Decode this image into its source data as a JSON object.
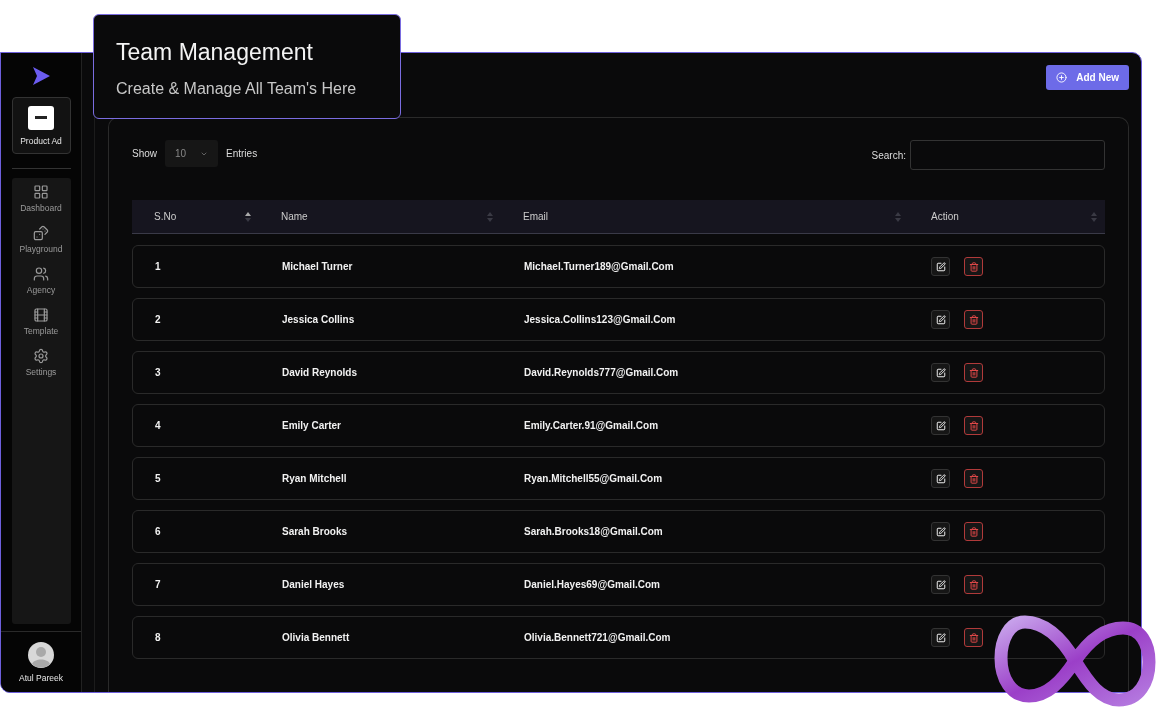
{
  "callout": {
    "title": "Team Management",
    "subtitle": "Create & Manage All Team's Here"
  },
  "sidebar": {
    "project": {
      "label": "Product Ad"
    },
    "items": [
      {
        "label": "Dashboard",
        "kind": "dashboard"
      },
      {
        "label": "Playground",
        "kind": "playground"
      },
      {
        "label": "Agency",
        "kind": "agency"
      },
      {
        "label": "Template",
        "kind": "template"
      },
      {
        "label": "Settings",
        "kind": "settings"
      }
    ],
    "user": {
      "name": "Atul Pareek"
    }
  },
  "header": {
    "add_button": "Add New"
  },
  "table_controls": {
    "show_label": "Show",
    "page_size": "10",
    "entries_label": "Entries",
    "search_label": "Search:"
  },
  "table": {
    "columns": [
      {
        "label": "S.No",
        "sorted": true
      },
      {
        "label": "Name",
        "sorted": false
      },
      {
        "label": "Email",
        "sorted": false
      },
      {
        "label": "Action",
        "sorted": false
      }
    ],
    "rows": [
      {
        "no": "1",
        "name": "Michael Turner",
        "email": "Michael.Turner189@Gmail.Com"
      },
      {
        "no": "2",
        "name": "Jessica Collins",
        "email": "Jessica.Collins123@Gmail.Com"
      },
      {
        "no": "3",
        "name": "David Reynolds",
        "email": "David.Reynolds777@Gmail.Com"
      },
      {
        "no": "4",
        "name": "Emily Carter",
        "email": "Emily.Carter.91@Gmail.Com"
      },
      {
        "no": "5",
        "name": "Ryan Mitchell",
        "email": "Ryan.Mitchell55@Gmail.Com"
      },
      {
        "no": "6",
        "name": "Sarah Brooks",
        "email": "Sarah.Brooks18@Gmail.Com"
      },
      {
        "no": "7",
        "name": "Daniel Hayes",
        "email": "Daniel.Hayes69@Gmail.Com"
      },
      {
        "no": "8",
        "name": "Olivia Bennett",
        "email": "Olivia.Bennett721@Gmail.Com"
      }
    ]
  }
}
